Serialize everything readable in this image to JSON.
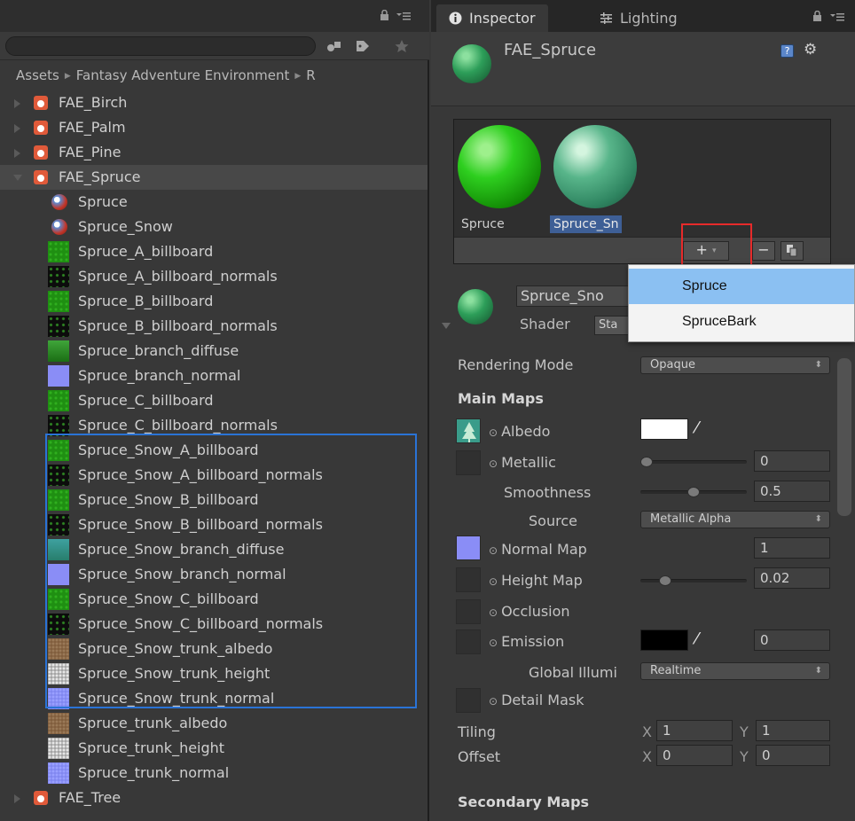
{
  "project": {
    "search": {
      "value": "",
      "placeholder": ""
    },
    "breadcrumb": [
      "Assets",
      "Fantasy Adventure Environment",
      "R"
    ],
    "tree": [
      {
        "label": "FAE_Birch",
        "kind": "prefab",
        "depth": 0,
        "fold": "closed"
      },
      {
        "label": "FAE_Palm",
        "kind": "prefab",
        "depth": 0,
        "fold": "closed"
      },
      {
        "label": "FAE_Pine",
        "kind": "prefab",
        "depth": 0,
        "fold": "closed"
      },
      {
        "label": "FAE_Spruce",
        "kind": "prefab",
        "depth": 0,
        "fold": "open",
        "selected": true
      },
      {
        "label": "Spruce",
        "kind": "material",
        "depth": 1
      },
      {
        "label": "Spruce_Snow",
        "kind": "material",
        "depth": 1
      },
      {
        "label": "Spruce_A_billboard",
        "kind": "tex-green",
        "depth": 1
      },
      {
        "label": "Spruce_A_billboard_normals",
        "kind": "tex-black",
        "depth": 1
      },
      {
        "label": "Spruce_B_billboard",
        "kind": "tex-green",
        "depth": 1
      },
      {
        "label": "Spruce_B_billboard_normals",
        "kind": "tex-black",
        "depth": 1
      },
      {
        "label": "Spruce_branch_diffuse",
        "kind": "tex-diffuse",
        "depth": 1
      },
      {
        "label": "Spruce_branch_normal",
        "kind": "tex-normal",
        "depth": 1
      },
      {
        "label": "Spruce_C_billboard",
        "kind": "tex-green",
        "depth": 1
      },
      {
        "label": "Spruce_C_billboard_normals",
        "kind": "tex-black",
        "depth": 1
      },
      {
        "label": "Spruce_Snow_A_billboard",
        "kind": "tex-green",
        "depth": 1
      },
      {
        "label": "Spruce_Snow_A_billboard_normals",
        "kind": "tex-black",
        "depth": 1
      },
      {
        "label": "Spruce_Snow_B_billboard",
        "kind": "tex-green",
        "depth": 1
      },
      {
        "label": "Spruce_Snow_B_billboard_normals",
        "kind": "tex-black",
        "depth": 1
      },
      {
        "label": "Spruce_Snow_branch_diffuse",
        "kind": "tex-snow-diffuse",
        "depth": 1
      },
      {
        "label": "Spruce_Snow_branch_normal",
        "kind": "tex-normal",
        "depth": 1
      },
      {
        "label": "Spruce_Snow_C_billboard",
        "kind": "tex-green",
        "depth": 1
      },
      {
        "label": "Spruce_Snow_C_billboard_normals",
        "kind": "tex-black",
        "depth": 1
      },
      {
        "label": "Spruce_Snow_trunk_albedo",
        "kind": "tex-brown",
        "depth": 1
      },
      {
        "label": "Spruce_Snow_trunk_height",
        "kind": "tex-grey",
        "depth": 1
      },
      {
        "label": "Spruce_Snow_trunk_normal",
        "kind": "tex-normal-noise",
        "depth": 1
      },
      {
        "label": "Spruce_trunk_albedo",
        "kind": "tex-brown",
        "depth": 1
      },
      {
        "label": "Spruce_trunk_height",
        "kind": "tex-grey",
        "depth": 1
      },
      {
        "label": "Spruce_trunk_normal",
        "kind": "tex-normal-noise",
        "depth": 1
      },
      {
        "label": "FAE_Tree",
        "kind": "prefab",
        "depth": 0,
        "fold": "closed"
      }
    ]
  },
  "inspector": {
    "tabs": [
      {
        "label": "Inspector",
        "icon": "info-icon"
      },
      {
        "label": "Lighting",
        "icon": "lighting-icon"
      }
    ],
    "object_title": "FAE_Spruce",
    "submaterials": [
      {
        "label": "Spruce",
        "selected": false
      },
      {
        "label": "Spruce_Sn",
        "selected": true
      }
    ],
    "toolbar": {
      "add": "+",
      "add_arrow": "▾",
      "remove": "−",
      "copy": "copy-icon"
    },
    "dropdown": [
      "Spruce",
      "SpruceBark"
    ],
    "material": {
      "name": "Spruce_Sno",
      "shader_label": "Shader",
      "shader_value": "Sta"
    },
    "rendering_mode": {
      "label": "Rendering Mode",
      "value": "Opaque"
    },
    "main_maps_title": "Main Maps",
    "albedo": "Albedo",
    "metallic": {
      "label": "Metallic",
      "value": "0",
      "level": 0
    },
    "smoothness": {
      "label": "Smoothness",
      "value": "0.5",
      "level": 0.5
    },
    "source": {
      "label": "Source",
      "value": "Metallic Alpha"
    },
    "normal_map": {
      "label": "Normal Map",
      "value": "1"
    },
    "height_map": {
      "label": "Height Map",
      "value": "0.02",
      "level": 0.2
    },
    "occlusion": "Occlusion",
    "emission": {
      "label": "Emission",
      "value": "0"
    },
    "global_illumination": {
      "label": "Global Illumi",
      "value": "Realtime"
    },
    "detail_mask": "Detail Mask",
    "tiling": {
      "label": "Tiling",
      "x_label": "X",
      "x": "1",
      "y_label": "Y",
      "y": "1"
    },
    "offset": {
      "label": "Offset",
      "x_label": "X",
      "x": "0",
      "y_label": "Y",
      "y": "0"
    },
    "secondary_maps_title": "Secondary Maps"
  },
  "colors": {
    "selection_blue": "#2a73d6",
    "highlight_red": "#e62a2a",
    "dropdown_highlight": "#8bc0f2"
  }
}
